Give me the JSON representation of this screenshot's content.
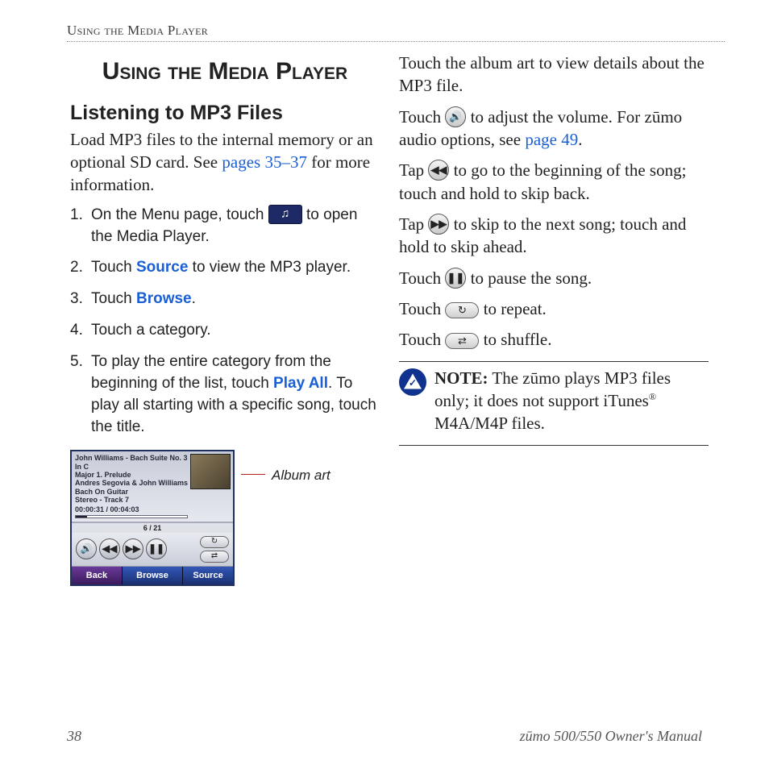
{
  "running_head": "Using the Media Player",
  "title": "Using the Media Player",
  "subtitle": "Listening to MP3 Files",
  "intro_a": "Load MP3 files to the internal memory or an optional SD card. See ",
  "intro_link": "pages 35–37",
  "intro_b": " for more information.",
  "steps": {
    "s1a": "On the Menu page, touch ",
    "s1b": " to open the Media Player.",
    "s2a": "Touch ",
    "s2_source": "Source",
    "s2b": " to view the MP3 player.",
    "s3a": "Touch ",
    "s3_browse": "Browse",
    "s3b": ".",
    "s4": "Touch a category.",
    "s5a": "To play the entire category from the beginning of the list, touch ",
    "s5_play": "Play All",
    "s5b": ". To play all starting with a specific song, touch the title."
  },
  "player": {
    "line1": "John Williams - Bach Suite No. 3 In C",
    "line2": "Major 1. Prelude",
    "line3": "Andres Segovia & John Williams",
    "line4": "Bach On Guitar",
    "line5": "Stereo - Track 7",
    "time": "00:00:31 / 00:04:03",
    "count": "6 / 21",
    "back": "Back",
    "browse": "Browse",
    "source": "Source"
  },
  "callout": "Album art",
  "r": {
    "p1": "Touch the album art to view details about the MP3 file.",
    "p2a": "Touch ",
    "p2b": " to adjust the volume. For zūmo audio options, see ",
    "p2_link": "page 49",
    "p2c": ".",
    "p3a": "Tap ",
    "p3b": " to go to the beginning of the song; touch and hold to skip back.",
    "p4a": "Tap ",
    "p4b": " to skip to the next song; touch and hold to skip ahead.",
    "p5a": "Touch ",
    "p5b": " to pause the song.",
    "p6a": "Touch ",
    "p6b": " to repeat.",
    "p7a": "Touch ",
    "p7b": " to shuffle."
  },
  "note": {
    "label": "NOTE:",
    "text_a": " The zūmo plays MP3 files only; it does not support iTunes",
    "reg": "®",
    "text_b": "  M4A/M4P files."
  },
  "footer": {
    "page": "38",
    "right": "zūmo 500/550 Owner's Manual"
  },
  "icons": {
    "volume": "🔊",
    "prev": "◀◀",
    "next": "▶▶",
    "pause": "❚❚",
    "repeat": "↻",
    "shuffle": "⇄"
  }
}
